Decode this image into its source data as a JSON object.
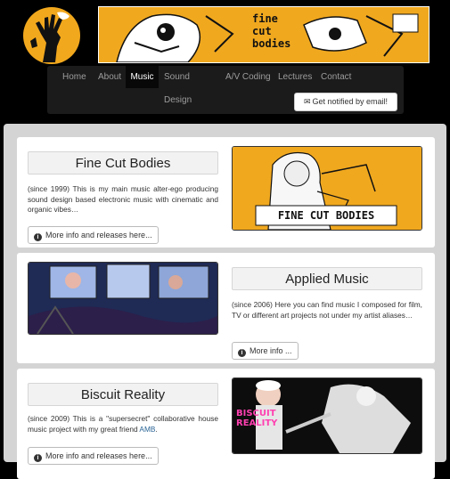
{
  "nav": {
    "items": [
      {
        "label": "Home",
        "active": false
      },
      {
        "label": "About",
        "active": false
      },
      {
        "label": "Music",
        "active": true
      },
      {
        "label": "Sound Design",
        "active": false
      },
      {
        "label": "A/V Coding",
        "active": false
      },
      {
        "label": "Lectures",
        "active": false
      },
      {
        "label": "Contact",
        "active": false
      }
    ],
    "notify_label": "Get notified by email!"
  },
  "cards": [
    {
      "title": "Fine Cut Bodies",
      "description": "(since 1999) This is my main music alter-ego producing sound design based electronic music with cinematic and organic vibes…",
      "button_label": "More info and releases here...",
      "image_text": "FINE CUT BODIES"
    },
    {
      "title": "Applied Music",
      "description": "(since 2006) Here you can find music I composed for film, TV or different art projects not under my artist aliases…",
      "button_label": "More info ..."
    },
    {
      "title": "Biscuit Reality",
      "description_prefix": "(since 2009) This is a \"supersecret\" collaborative house music project with my great friend ",
      "description_link": "AMB",
      "description_suffix": ".",
      "button_label": "More info and releases here...",
      "image_text": "BISCUIT REALITY"
    }
  ],
  "banner_text": "fine cut bodies",
  "colors": {
    "brand": "#f0a81f",
    "nav_bg": "#1b1b1b",
    "page_bg": "#d4d4d4",
    "link": "#2a6496"
  }
}
